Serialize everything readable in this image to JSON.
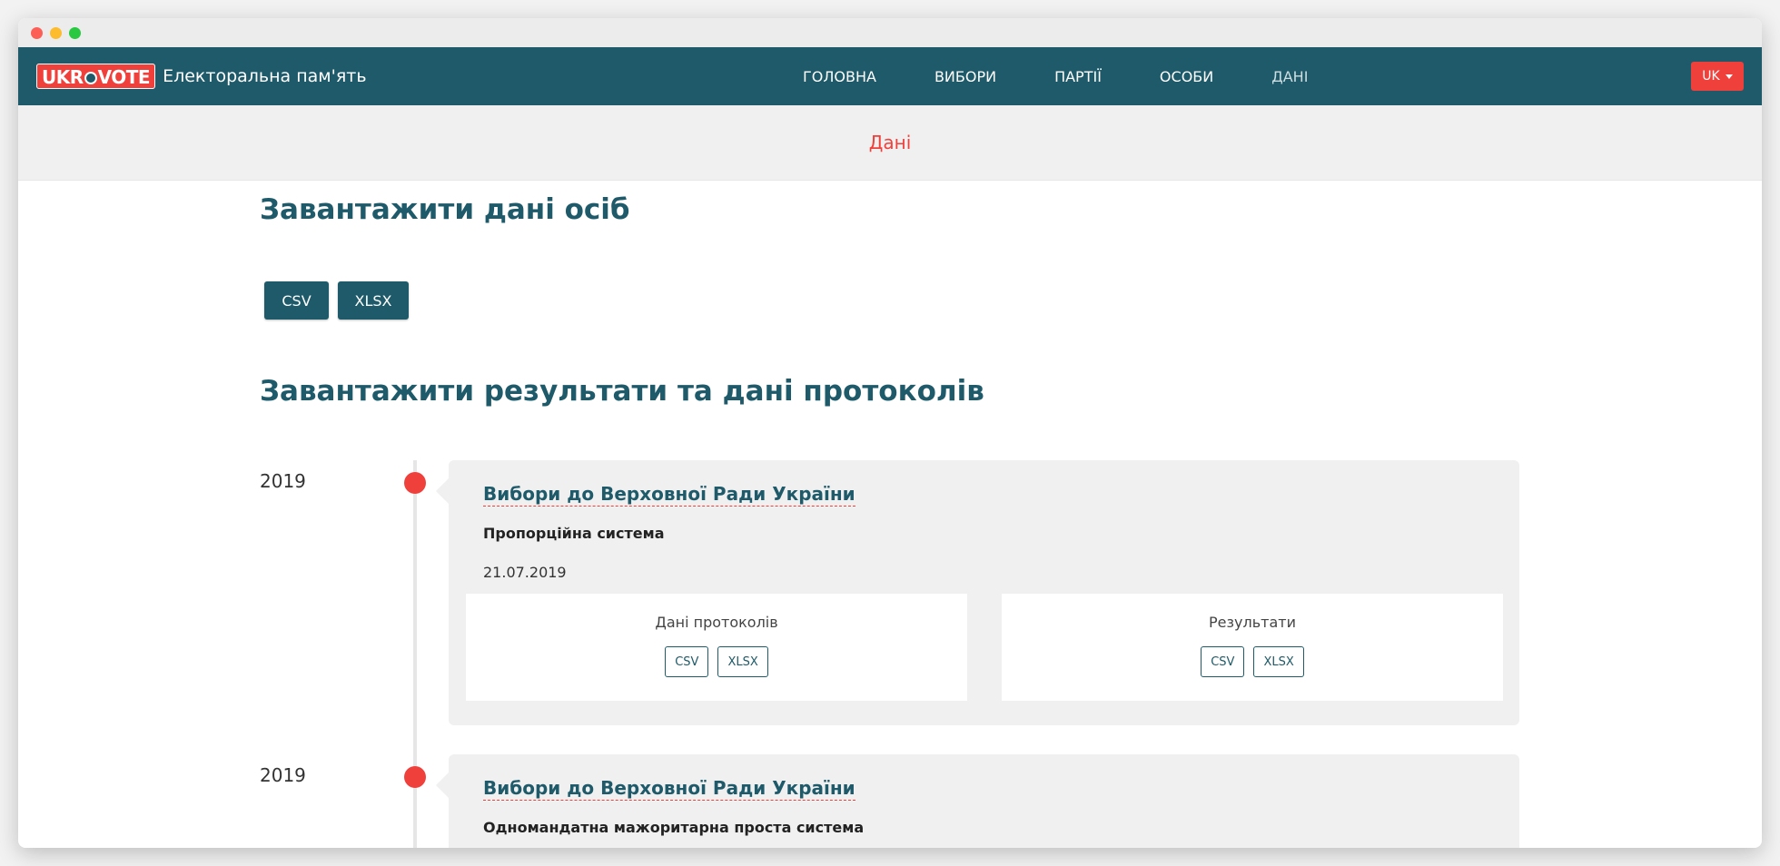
{
  "brand": {
    "logo": "UKR VOTE",
    "logo_left": "UKR",
    "logo_right": "VOTE",
    "title": "Електоральна пам'ять"
  },
  "nav": {
    "items": [
      {
        "label": "ГОЛОВНА"
      },
      {
        "label": "ВИБОРИ"
      },
      {
        "label": "ПАРТІЇ"
      },
      {
        "label": "ОСОБИ"
      },
      {
        "label": "ДАНІ"
      }
    ],
    "active_item": "ДАНІ",
    "language": "UK"
  },
  "subheader": {
    "breadcrumb": "Дані"
  },
  "persons_section": {
    "heading": "Завантажити дані осіб",
    "buttons": [
      "CSV",
      "XLSX"
    ]
  },
  "results_section": {
    "heading": "Завантажити результати та дані протоколів",
    "entries": [
      {
        "year": "2019",
        "title": "Вибори до Верховної Ради України",
        "system": "Пропорційна система",
        "date": "21.07.2019",
        "panels": [
          {
            "title": "Дані протоколів",
            "buttons": [
              "CSV",
              "XLSX"
            ]
          },
          {
            "title": "Результати",
            "buttons": [
              "CSV",
              "XLSX"
            ]
          }
        ]
      },
      {
        "year": "2019",
        "title": "Вибори до Верховної Ради України",
        "system": "Одномандатна мажоритарна проста система"
      }
    ]
  },
  "colors": {
    "primary": "#1e5a69",
    "accent": "#f0403c",
    "card_bg": "#f0f0f0"
  }
}
